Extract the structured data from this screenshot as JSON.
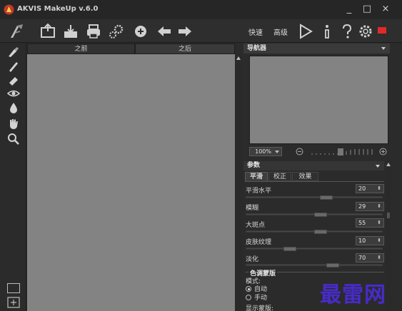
{
  "app": {
    "title": "AKVIS MakeUp v.6.0"
  },
  "window_controls": {
    "minimize": "_",
    "maximize": "□",
    "close": "×"
  },
  "toolbar": {
    "icons": [
      "makeup-logo-icon",
      "open-image-icon",
      "save-image-icon",
      "print-icon",
      "batch-gears-icon",
      "share-icon",
      "undo-arrow-icon",
      "redo-arrow-icon"
    ],
    "quick_label": "快速",
    "advanced_label": "高级",
    "right_icons": [
      "run-play-icon",
      "info-icon",
      "help-icon",
      "settings-gear-icon",
      "notification-icon"
    ]
  },
  "tools": [
    "retouch-brush-icon",
    "pencil-icon",
    "eraser-icon",
    "eye-icon",
    "drop-icon",
    "hand-icon",
    "zoom-icon"
  ],
  "canvas_tabs": {
    "before": "之前",
    "after": "之后"
  },
  "navigator": {
    "title": "导航器",
    "zoom_value": "100%"
  },
  "params": {
    "title": "参数",
    "tabs": [
      "平滑",
      "校正",
      "效果"
    ],
    "active_tab": "平滑",
    "sliders": [
      {
        "label": "平滑水平",
        "value": "20",
        "level": 0.6
      },
      {
        "label": "模糊",
        "value": "29",
        "level": 0.55
      },
      {
        "label": "大斑点",
        "value": "55",
        "level": 0.55
      },
      {
        "label": "皮肤纹理",
        "value": "10",
        "level": 0.3
      },
      {
        "label": "淡化",
        "value": "70",
        "level": 0.65
      }
    ],
    "mask_group": {
      "title": "色调蒙版",
      "mode_label": "模式:",
      "options": [
        "自动",
        "手动"
      ],
      "selected": "自动",
      "display_label": "显示蒙版:"
    }
  },
  "watermark_text": "最雷网",
  "colors": {
    "canvas": "#838383",
    "panel": "#2b2b2b",
    "accent_red": "#e02a2a",
    "watermark": "#4a2bd2"
  }
}
